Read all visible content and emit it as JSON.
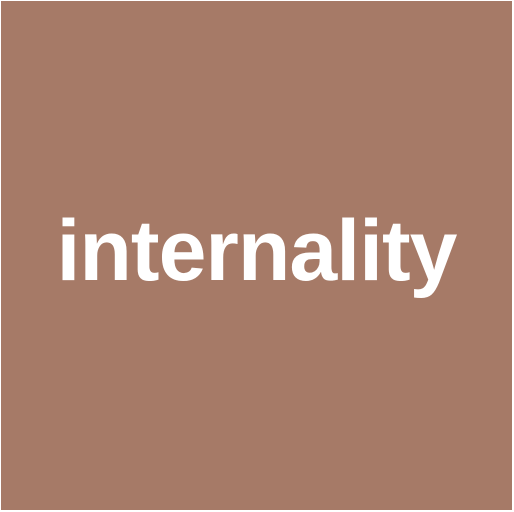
{
  "tile": {
    "text": "internality",
    "background_color": "#a67a67",
    "text_color": "#ffffff"
  }
}
